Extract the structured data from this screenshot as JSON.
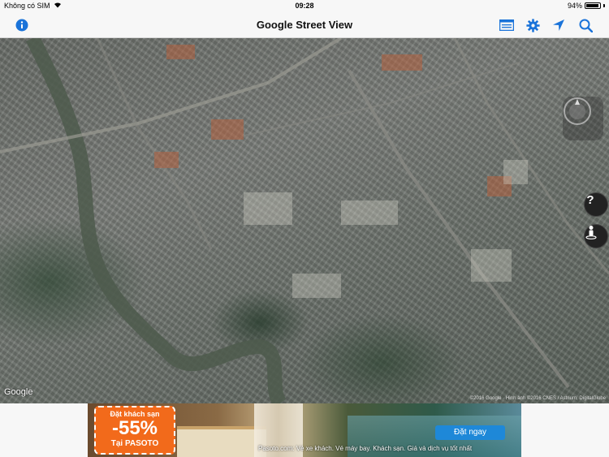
{
  "status_bar": {
    "carrier": "Không có SIM",
    "time": "09:28",
    "battery_text": "94%",
    "battery_level": 0.94
  },
  "nav": {
    "title": "Google Street View",
    "left_icon": "info-icon",
    "right_icons": [
      "list-view-icon",
      "gear-icon",
      "location-arrow-icon",
      "search-icon"
    ]
  },
  "map": {
    "type": "satellite",
    "logo_text": "Google",
    "attribution": "©2016 Google · Hình ảnh ©2016 CNES / Astrium, DigitalGlobe",
    "controls": [
      "compass-control",
      "help-icon",
      "pegman-icon"
    ]
  },
  "ad": {
    "badge_line1": "Đặt khách sạn",
    "badge_percent": "-55%",
    "badge_brand": "Tại PASOTO",
    "cta_label": "Đặt ngay",
    "caption": "Pasoto.com: Vé xe khách. Vé máy bay. Khách sạn. Giá và dịch vụ tốt nhất"
  },
  "colors": {
    "accent": "#1a73d9",
    "ad_orange": "#f26a1b",
    "ad_cta": "#1e88d8"
  }
}
